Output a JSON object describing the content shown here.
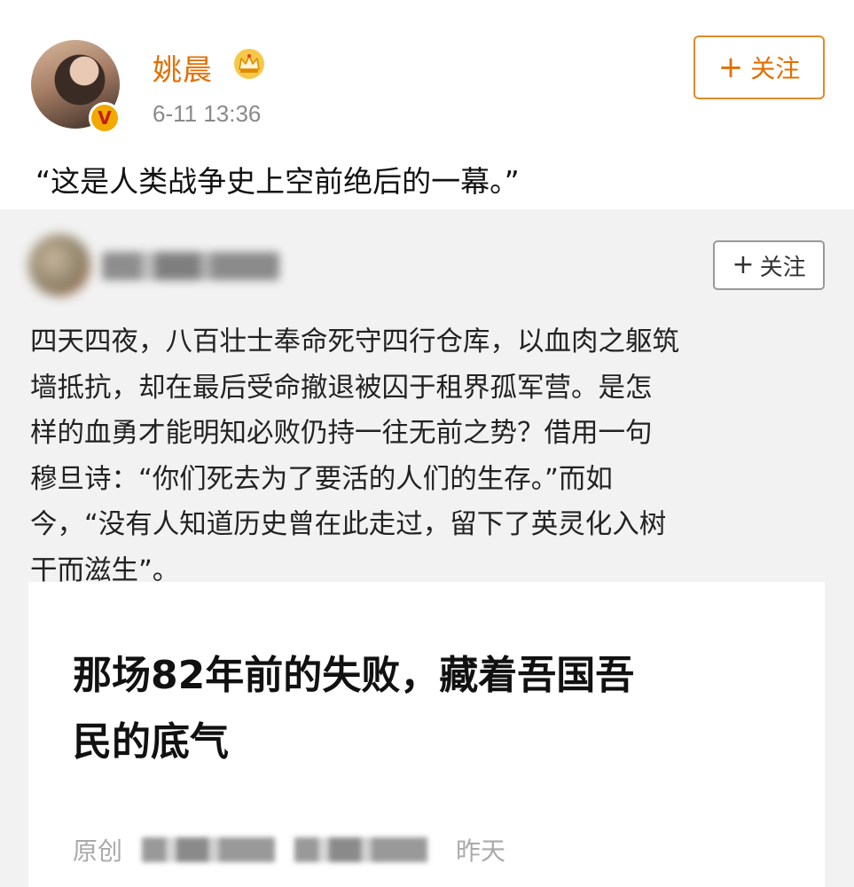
{
  "post": {
    "username": "姚晨",
    "timestamp": "6-11 13:36",
    "follow_label": "关注",
    "verify_badge": "V",
    "text": "“这是人类战争史上空前绝后的一幕。”"
  },
  "repost": {
    "follow_label": "关注",
    "lines": [
      "四天四夜，八百壮士奉命死守四行仓库，以血肉之躯筑",
      "墙抵抗，却在最后受命撤退被囚于租界孤军营。是怎",
      "样的血勇才能明知必败仍持一往无前之势？借用一句",
      "穆旦诗：“你们死去为了要活的人们的生存。”而如",
      "今，“没有人知道历史曾在此走过，留下了英灵化入树",
      "干而滋生”。"
    ],
    "article": {
      "title_lines": [
        "那场82年前的失败，藏着吾国吾",
        "民的底气"
      ],
      "source_label": "原创",
      "date": "昨天"
    }
  },
  "colors": {
    "username": "#e36f00",
    "follow_border": "#e08a2c",
    "badge": "#f2a900",
    "card_bg": "#f2f2f2"
  }
}
